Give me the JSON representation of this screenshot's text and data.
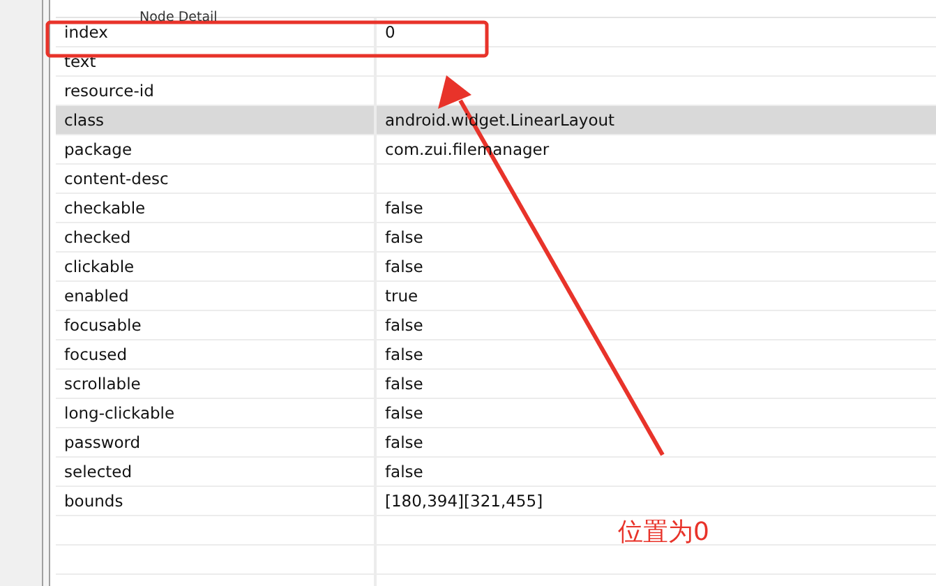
{
  "panel": {
    "title": "Node Detail"
  },
  "rows": [
    {
      "key": "index",
      "value": "0",
      "selected": false
    },
    {
      "key": "text",
      "value": "",
      "selected": false
    },
    {
      "key": "resource-id",
      "value": "",
      "selected": false
    },
    {
      "key": "class",
      "value": "android.widget.LinearLayout",
      "selected": true
    },
    {
      "key": "package",
      "value": "com.zui.filemanager",
      "selected": false
    },
    {
      "key": "content-desc",
      "value": "",
      "selected": false
    },
    {
      "key": "checkable",
      "value": "false",
      "selected": false
    },
    {
      "key": "checked",
      "value": "false",
      "selected": false
    },
    {
      "key": "clickable",
      "value": "false",
      "selected": false
    },
    {
      "key": "enabled",
      "value": "true",
      "selected": false
    },
    {
      "key": "focusable",
      "value": "false",
      "selected": false
    },
    {
      "key": "focused",
      "value": "false",
      "selected": false
    },
    {
      "key": "scrollable",
      "value": "false",
      "selected": false
    },
    {
      "key": "long-clickable",
      "value": "false",
      "selected": false
    },
    {
      "key": "password",
      "value": "false",
      "selected": false
    },
    {
      "key": "selected",
      "value": "false",
      "selected": false
    },
    {
      "key": "bounds",
      "value": "[180,394][321,455]",
      "selected": false
    }
  ],
  "annotation": {
    "label": "位置为0"
  }
}
